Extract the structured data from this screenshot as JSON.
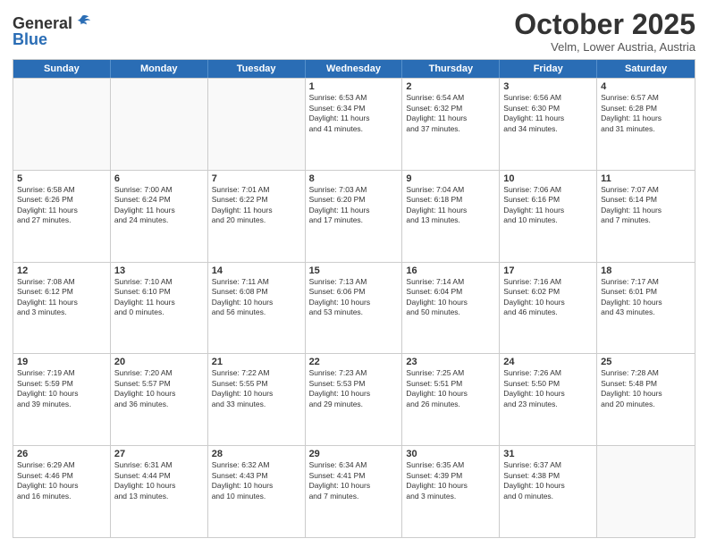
{
  "header": {
    "logo_line1": "General",
    "logo_line2": "Blue",
    "month": "October 2025",
    "location": "Velm, Lower Austria, Austria"
  },
  "weekdays": [
    "Sunday",
    "Monday",
    "Tuesday",
    "Wednesday",
    "Thursday",
    "Friday",
    "Saturday"
  ],
  "rows": [
    [
      {
        "day": "",
        "info": ""
      },
      {
        "day": "",
        "info": ""
      },
      {
        "day": "",
        "info": ""
      },
      {
        "day": "1",
        "info": "Sunrise: 6:53 AM\nSunset: 6:34 PM\nDaylight: 11 hours\nand 41 minutes."
      },
      {
        "day": "2",
        "info": "Sunrise: 6:54 AM\nSunset: 6:32 PM\nDaylight: 11 hours\nand 37 minutes."
      },
      {
        "day": "3",
        "info": "Sunrise: 6:56 AM\nSunset: 6:30 PM\nDaylight: 11 hours\nand 34 minutes."
      },
      {
        "day": "4",
        "info": "Sunrise: 6:57 AM\nSunset: 6:28 PM\nDaylight: 11 hours\nand 31 minutes."
      }
    ],
    [
      {
        "day": "5",
        "info": "Sunrise: 6:58 AM\nSunset: 6:26 PM\nDaylight: 11 hours\nand 27 minutes."
      },
      {
        "day": "6",
        "info": "Sunrise: 7:00 AM\nSunset: 6:24 PM\nDaylight: 11 hours\nand 24 minutes."
      },
      {
        "day": "7",
        "info": "Sunrise: 7:01 AM\nSunset: 6:22 PM\nDaylight: 11 hours\nand 20 minutes."
      },
      {
        "day": "8",
        "info": "Sunrise: 7:03 AM\nSunset: 6:20 PM\nDaylight: 11 hours\nand 17 minutes."
      },
      {
        "day": "9",
        "info": "Sunrise: 7:04 AM\nSunset: 6:18 PM\nDaylight: 11 hours\nand 13 minutes."
      },
      {
        "day": "10",
        "info": "Sunrise: 7:06 AM\nSunset: 6:16 PM\nDaylight: 11 hours\nand 10 minutes."
      },
      {
        "day": "11",
        "info": "Sunrise: 7:07 AM\nSunset: 6:14 PM\nDaylight: 11 hours\nand 7 minutes."
      }
    ],
    [
      {
        "day": "12",
        "info": "Sunrise: 7:08 AM\nSunset: 6:12 PM\nDaylight: 11 hours\nand 3 minutes."
      },
      {
        "day": "13",
        "info": "Sunrise: 7:10 AM\nSunset: 6:10 PM\nDaylight: 11 hours\nand 0 minutes."
      },
      {
        "day": "14",
        "info": "Sunrise: 7:11 AM\nSunset: 6:08 PM\nDaylight: 10 hours\nand 56 minutes."
      },
      {
        "day": "15",
        "info": "Sunrise: 7:13 AM\nSunset: 6:06 PM\nDaylight: 10 hours\nand 53 minutes."
      },
      {
        "day": "16",
        "info": "Sunrise: 7:14 AM\nSunset: 6:04 PM\nDaylight: 10 hours\nand 50 minutes."
      },
      {
        "day": "17",
        "info": "Sunrise: 7:16 AM\nSunset: 6:02 PM\nDaylight: 10 hours\nand 46 minutes."
      },
      {
        "day": "18",
        "info": "Sunrise: 7:17 AM\nSunset: 6:01 PM\nDaylight: 10 hours\nand 43 minutes."
      }
    ],
    [
      {
        "day": "19",
        "info": "Sunrise: 7:19 AM\nSunset: 5:59 PM\nDaylight: 10 hours\nand 39 minutes."
      },
      {
        "day": "20",
        "info": "Sunrise: 7:20 AM\nSunset: 5:57 PM\nDaylight: 10 hours\nand 36 minutes."
      },
      {
        "day": "21",
        "info": "Sunrise: 7:22 AM\nSunset: 5:55 PM\nDaylight: 10 hours\nand 33 minutes."
      },
      {
        "day": "22",
        "info": "Sunrise: 7:23 AM\nSunset: 5:53 PM\nDaylight: 10 hours\nand 29 minutes."
      },
      {
        "day": "23",
        "info": "Sunrise: 7:25 AM\nSunset: 5:51 PM\nDaylight: 10 hours\nand 26 minutes."
      },
      {
        "day": "24",
        "info": "Sunrise: 7:26 AM\nSunset: 5:50 PM\nDaylight: 10 hours\nand 23 minutes."
      },
      {
        "day": "25",
        "info": "Sunrise: 7:28 AM\nSunset: 5:48 PM\nDaylight: 10 hours\nand 20 minutes."
      }
    ],
    [
      {
        "day": "26",
        "info": "Sunrise: 6:29 AM\nSunset: 4:46 PM\nDaylight: 10 hours\nand 16 minutes."
      },
      {
        "day": "27",
        "info": "Sunrise: 6:31 AM\nSunset: 4:44 PM\nDaylight: 10 hours\nand 13 minutes."
      },
      {
        "day": "28",
        "info": "Sunrise: 6:32 AM\nSunset: 4:43 PM\nDaylight: 10 hours\nand 10 minutes."
      },
      {
        "day": "29",
        "info": "Sunrise: 6:34 AM\nSunset: 4:41 PM\nDaylight: 10 hours\nand 7 minutes."
      },
      {
        "day": "30",
        "info": "Sunrise: 6:35 AM\nSunset: 4:39 PM\nDaylight: 10 hours\nand 3 minutes."
      },
      {
        "day": "31",
        "info": "Sunrise: 6:37 AM\nSunset: 4:38 PM\nDaylight: 10 hours\nand 0 minutes."
      },
      {
        "day": "",
        "info": ""
      }
    ]
  ]
}
